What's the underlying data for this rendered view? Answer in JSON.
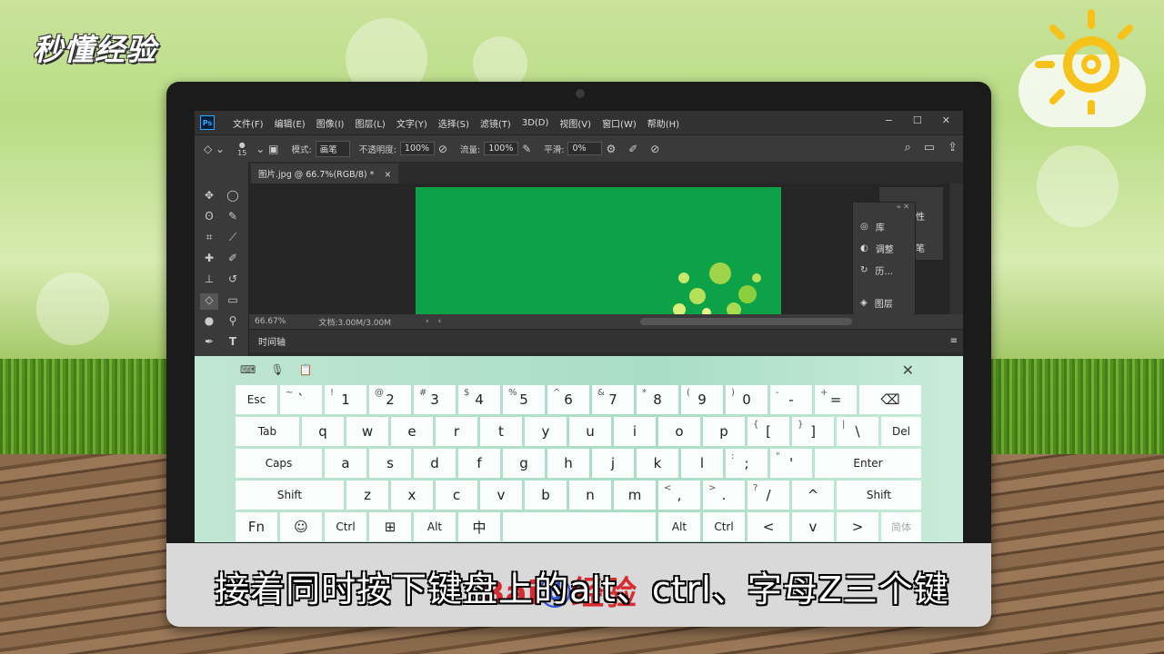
{
  "watermark": {
    "brand": "秒懂经验",
    "bottom_logo_left": "Bai",
    "bottom_logo_right": "经验"
  },
  "photoshop": {
    "app_icon": "Ps",
    "menus": [
      "文件(F)",
      "编辑(E)",
      "图像(I)",
      "图层(L)",
      "文字(Y)",
      "选择(S)",
      "滤镜(T)",
      "3D(D)",
      "视图(V)",
      "窗口(W)",
      "帮助(H)"
    ],
    "window_controls": {
      "minimize": "−",
      "maximize": "☐",
      "close": "✕"
    },
    "options": {
      "brush_size": "15",
      "mode_label": "模式:",
      "mode_value": "画笔",
      "opacity_label": "不透明度:",
      "opacity_value": "100%",
      "flow_label": "流量:",
      "flow_value": "100%",
      "smooth_label": "平滑:",
      "smooth_value": "0%"
    },
    "doc_tab": "图片.jpg @ 66.7%(RGB/8) *",
    "doc_tab_close": "×",
    "status_zoom": "66.67%",
    "status_doc": "文档:3.00M/3.00M",
    "timeline_label": "时间轴",
    "panel_items": [
      {
        "label": "库",
        "icon": "libraries-icon"
      },
      {
        "label": "调整",
        "icon": "adjustments-icon"
      },
      {
        "label": "历...",
        "icon": "history-icon"
      },
      {
        "label": "图层",
        "icon": "layers-icon"
      }
    ],
    "panel2_items": [
      "性",
      "笔"
    ]
  },
  "keyboard": {
    "row1": [
      {
        "main": "Esc"
      },
      {
        "main": "`",
        "sub": "~"
      },
      {
        "main": "1",
        "sub": "!"
      },
      {
        "main": "2",
        "sub": "@"
      },
      {
        "main": "3",
        "sub": "#"
      },
      {
        "main": "4",
        "sub": "$"
      },
      {
        "main": "5",
        "sub": "%"
      },
      {
        "main": "6",
        "sub": "^"
      },
      {
        "main": "7",
        "sub": "&"
      },
      {
        "main": "8",
        "sub": "*"
      },
      {
        "main": "9",
        "sub": "("
      },
      {
        "main": "0",
        "sub": ")"
      },
      {
        "main": "-",
        "sub": "-"
      },
      {
        "main": "=",
        "sub": "+"
      },
      {
        "main": "⌫"
      }
    ],
    "row2": [
      {
        "main": "Tab"
      },
      {
        "main": "q"
      },
      {
        "main": "w"
      },
      {
        "main": "e"
      },
      {
        "main": "r"
      },
      {
        "main": "t"
      },
      {
        "main": "y"
      },
      {
        "main": "u"
      },
      {
        "main": "i"
      },
      {
        "main": "o"
      },
      {
        "main": "p"
      },
      {
        "main": "[",
        "sub": "{"
      },
      {
        "main": "]",
        "sub": "}"
      },
      {
        "main": "\\",
        "sub": "|"
      },
      {
        "main": "Del"
      }
    ],
    "row3": [
      {
        "main": "Caps"
      },
      {
        "main": "a"
      },
      {
        "main": "s"
      },
      {
        "main": "d"
      },
      {
        "main": "f"
      },
      {
        "main": "g"
      },
      {
        "main": "h"
      },
      {
        "main": "j"
      },
      {
        "main": "k"
      },
      {
        "main": "l"
      },
      {
        "main": ";",
        "sub": ":"
      },
      {
        "main": "'",
        "sub": "\""
      },
      {
        "main": "Enter"
      }
    ],
    "row4": [
      {
        "main": "Shift"
      },
      {
        "main": "z"
      },
      {
        "main": "x"
      },
      {
        "main": "c"
      },
      {
        "main": "v"
      },
      {
        "main": "b"
      },
      {
        "main": "n"
      },
      {
        "main": "m"
      },
      {
        "main": ",",
        "sub": "<"
      },
      {
        "main": ".",
        "sub": ">"
      },
      {
        "main": "/",
        "sub": "?"
      },
      {
        "main": "^"
      },
      {
        "main": "Shift"
      }
    ],
    "row5": [
      {
        "main": "Fn"
      },
      {
        "main": "☺"
      },
      {
        "main": "Ctrl"
      },
      {
        "main": "⊞"
      },
      {
        "main": "Alt"
      },
      {
        "main": "中"
      },
      {
        "main": ""
      },
      {
        "main": "Alt"
      },
      {
        "main": "Ctrl"
      },
      {
        "main": "<"
      },
      {
        "main": "v"
      },
      {
        "main": ">"
      },
      {
        "main": "简体"
      }
    ],
    "close": "✕"
  },
  "caption": "接着同时按下键盘上的alt、ctrl、字母Z三个键"
}
